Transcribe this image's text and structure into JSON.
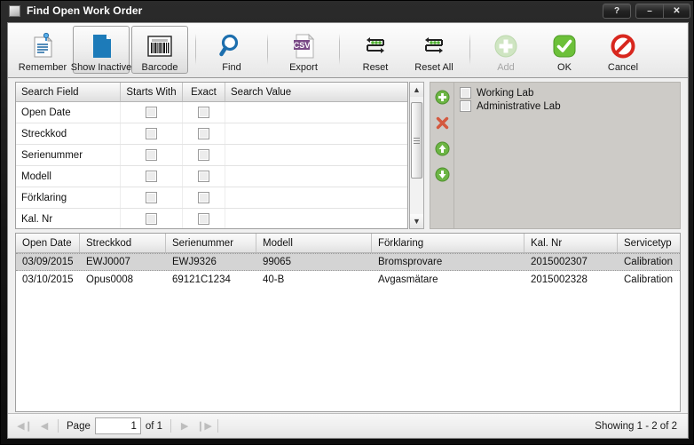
{
  "window": {
    "title": "Find Open Work Order",
    "app_icon": "window-icon",
    "controls": [
      {
        "name": "help-button",
        "glyph": "?"
      },
      {
        "name": "minimize-button",
        "glyph": "–"
      },
      {
        "name": "close-button",
        "glyph": "✕"
      }
    ]
  },
  "toolbar": {
    "items": [
      {
        "label": "Remember",
        "icon": "note-pin-icon",
        "framed": false,
        "disabled": false
      },
      {
        "label": "Show Inactive",
        "icon": "document-page-icon",
        "framed": true,
        "disabled": false
      },
      {
        "label": "Barcode",
        "icon": "barcode-icon",
        "framed": true,
        "disabled": false
      },
      {
        "label": "Find",
        "icon": "magnifier-icon",
        "framed": false,
        "disabled": false
      },
      {
        "label": "Export",
        "icon": "csv-file-icon",
        "framed": false,
        "disabled": false
      },
      {
        "label": "Reset",
        "icon": "reset-arrows-icon",
        "framed": false,
        "disabled": false
      },
      {
        "label": "Reset All",
        "icon": "reset-all-arrows-icon",
        "framed": false,
        "disabled": false
      },
      {
        "label": "Add",
        "icon": "plus-circle-icon",
        "framed": false,
        "disabled": true
      },
      {
        "label": "OK",
        "icon": "green-check-icon",
        "framed": false,
        "disabled": false
      },
      {
        "label": "Cancel",
        "icon": "red-cancel-icon",
        "framed": false,
        "disabled": false
      }
    ]
  },
  "search_panel": {
    "columns": [
      "Search Field",
      "Starts With",
      "Exact",
      "Search Value"
    ],
    "rows": [
      {
        "field": "Open Date",
        "starts_with": false,
        "exact": false,
        "value": ""
      },
      {
        "field": "Streckkod",
        "starts_with": false,
        "exact": false,
        "value": ""
      },
      {
        "field": "Serienummer",
        "starts_with": false,
        "exact": false,
        "value": ""
      },
      {
        "field": "Modell",
        "starts_with": false,
        "exact": false,
        "value": ""
      },
      {
        "field": "Förklaring",
        "starts_with": false,
        "exact": false,
        "value": ""
      },
      {
        "field": "Kal. Nr",
        "starts_with": false,
        "exact": false,
        "value": ""
      }
    ],
    "side_buttons": [
      {
        "name": "add-lab-button",
        "icon": "green-plus-circle-icon"
      },
      {
        "name": "delete-lab-button",
        "icon": "red-x-icon"
      },
      {
        "name": "move-up-button",
        "icon": "green-up-arrow-icon"
      },
      {
        "name": "move-down-button",
        "icon": "green-down-arrow-icon"
      }
    ],
    "labs": [
      {
        "label": "Working Lab",
        "checked": false
      },
      {
        "label": "Administrative Lab",
        "checked": false
      }
    ]
  },
  "results": {
    "columns": [
      "Open Date",
      "Streckkod",
      "Serienummer",
      "Modell",
      "Förklaring",
      "Kal. Nr",
      "Servicetyp"
    ],
    "rows": [
      {
        "open_date": "03/09/2015",
        "streckkod": "EWJ0007",
        "serienummer": "EWJ9326",
        "modell": "99065",
        "forklaring": "Bromsprovare",
        "kal_nr": "2015002307",
        "servicetyp": "Calibration",
        "selected": true
      },
      {
        "open_date": "03/10/2015",
        "streckkod": "Opus0008",
        "serienummer": "69121C1234",
        "modell": "40-B",
        "forklaring": "Avgasmätare",
        "kal_nr": "2015002328",
        "servicetyp": "Calibration",
        "selected": false
      }
    ]
  },
  "statusbar": {
    "first_page_glyph": "◀❙",
    "prev_page_glyph": "◀",
    "page_label": "Page",
    "page_value": "1",
    "of_label": "of 1",
    "next_page_glyph": "▶",
    "last_page_glyph": "❙▶",
    "showing_text": "Showing 1 - 2 of 2"
  },
  "colors": {
    "accent_blue": "#1d7bb9",
    "green": "#5aa832",
    "red": "#cc3322",
    "purple": "#7a4a86",
    "title_text": "#ffffff"
  }
}
